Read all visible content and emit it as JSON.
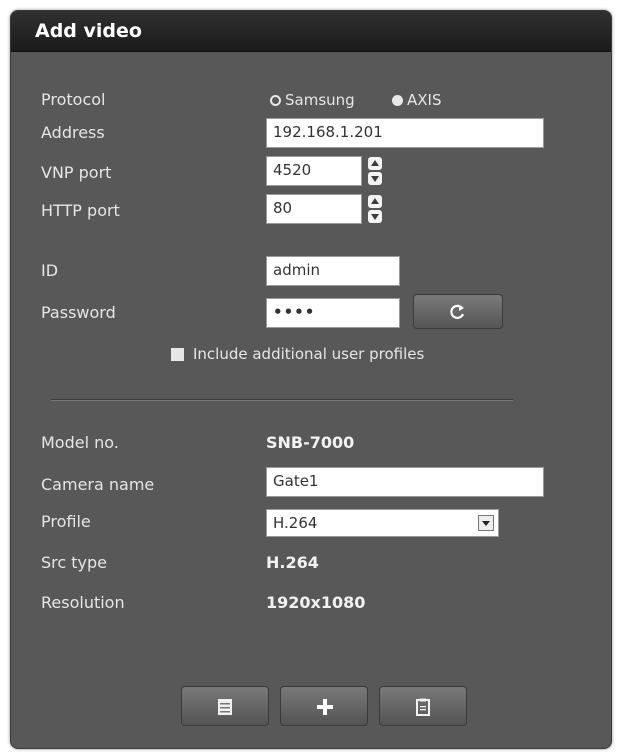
{
  "dialog": {
    "title": "Add video"
  },
  "protocol": {
    "label": "Protocol",
    "options": [
      {
        "label": "Samsung",
        "selected": false
      },
      {
        "label": "AXIS",
        "selected": true
      }
    ]
  },
  "address": {
    "label": "Address",
    "value": "192.168.1.201"
  },
  "vnp_port": {
    "label": "VNP port",
    "value": "4520"
  },
  "http_port": {
    "label": "HTTP port",
    "value": "80"
  },
  "id": {
    "label": "ID",
    "value": "admin"
  },
  "password": {
    "label": "Password",
    "value": "••••"
  },
  "include_profiles": {
    "label": "Include additional user profiles",
    "checked": false
  },
  "model_no": {
    "label": "Model no.",
    "value": "SNB-7000"
  },
  "camera_name": {
    "label": "Camera name",
    "value": "Gate1"
  },
  "profile": {
    "label": "Profile",
    "value": "H.264"
  },
  "src_type": {
    "label": "Src type",
    "value": "H.264"
  },
  "resolution": {
    "label": "Resolution",
    "value": "1920x1080"
  },
  "icons": {
    "refresh": "refresh-icon",
    "list": "list-icon",
    "add": "plus-icon",
    "clipboard": "clipboard-icon"
  },
  "colors": {
    "panel_bg": "#585858",
    "titlebar_bg": "#1e1e1e",
    "label_text": "#e6e6e6",
    "button_bg": "#666666"
  }
}
